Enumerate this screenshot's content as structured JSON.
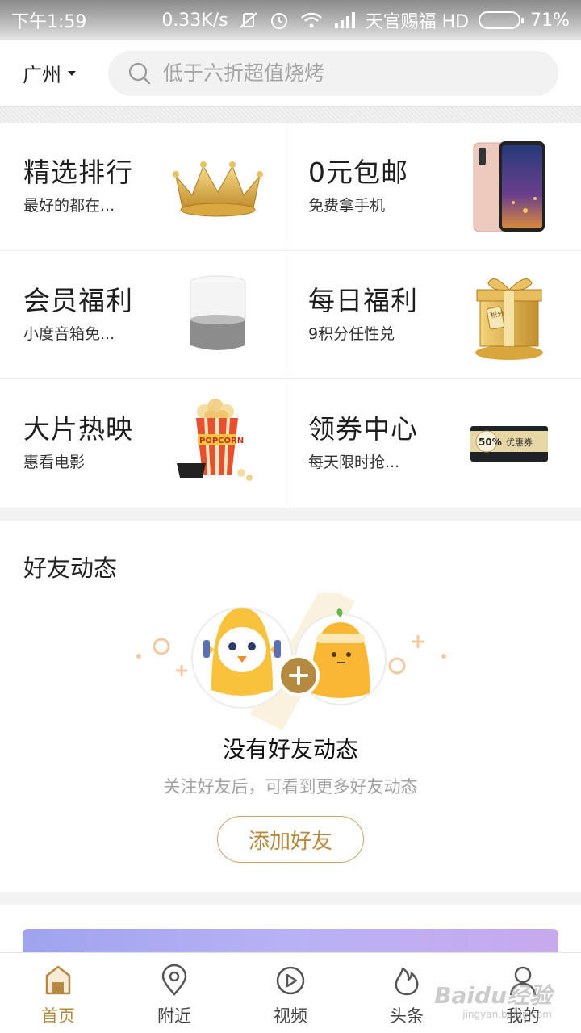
{
  "status_bar": {
    "time": "下午1:59",
    "speed": "0.33K/s",
    "carrier": "天官赐福 HD",
    "battery": "71%",
    "battery_level": 0.71
  },
  "header": {
    "city": "广州",
    "search_placeholder": "低于六折超值烧烤"
  },
  "grid": [
    {
      "title": "精选排行",
      "subtitle": "最好的都在...",
      "icon": "crown-icon"
    },
    {
      "title": "0元包邮",
      "subtitle": "免费拿手机",
      "icon": "phone-icon"
    },
    {
      "title": "会员福利",
      "subtitle": "小度音箱免...",
      "icon": "speaker-icon"
    },
    {
      "title": "每日福利",
      "subtitle": "9积分任性兑",
      "icon": "gift-box-icon",
      "icon_text": "积分"
    },
    {
      "title": "大片热映",
      "subtitle": "惠看电影",
      "icon": "popcorn-icon",
      "icon_text": "POPCORN"
    },
    {
      "title": "领券中心",
      "subtitle": "每天限时抢...",
      "icon": "coupon-icon",
      "icon_text": "50%",
      "icon_text2": "优惠券"
    }
  ],
  "friends": {
    "section_title": "好友动态",
    "empty_title": "没有好友动态",
    "empty_subtitle": "关注好友后，可看到更多好友动态",
    "add_button": "添加好友"
  },
  "tabbar": {
    "tabs": [
      {
        "label": "首页",
        "icon": "home-icon",
        "active": true
      },
      {
        "label": "附近",
        "icon": "location-icon",
        "active": false
      },
      {
        "label": "视频",
        "icon": "video-icon",
        "active": false
      },
      {
        "label": "头条",
        "icon": "flame-icon",
        "active": false
      },
      {
        "label": "我的",
        "icon": "profile-icon",
        "active": false
      }
    ]
  },
  "watermark": {
    "text": "Baidu经验",
    "sub": "jingyan.baidu.com"
  },
  "colors": {
    "accent": "#b58a40",
    "accent_border": "#c9a56a",
    "gold": "#e0b24a"
  }
}
